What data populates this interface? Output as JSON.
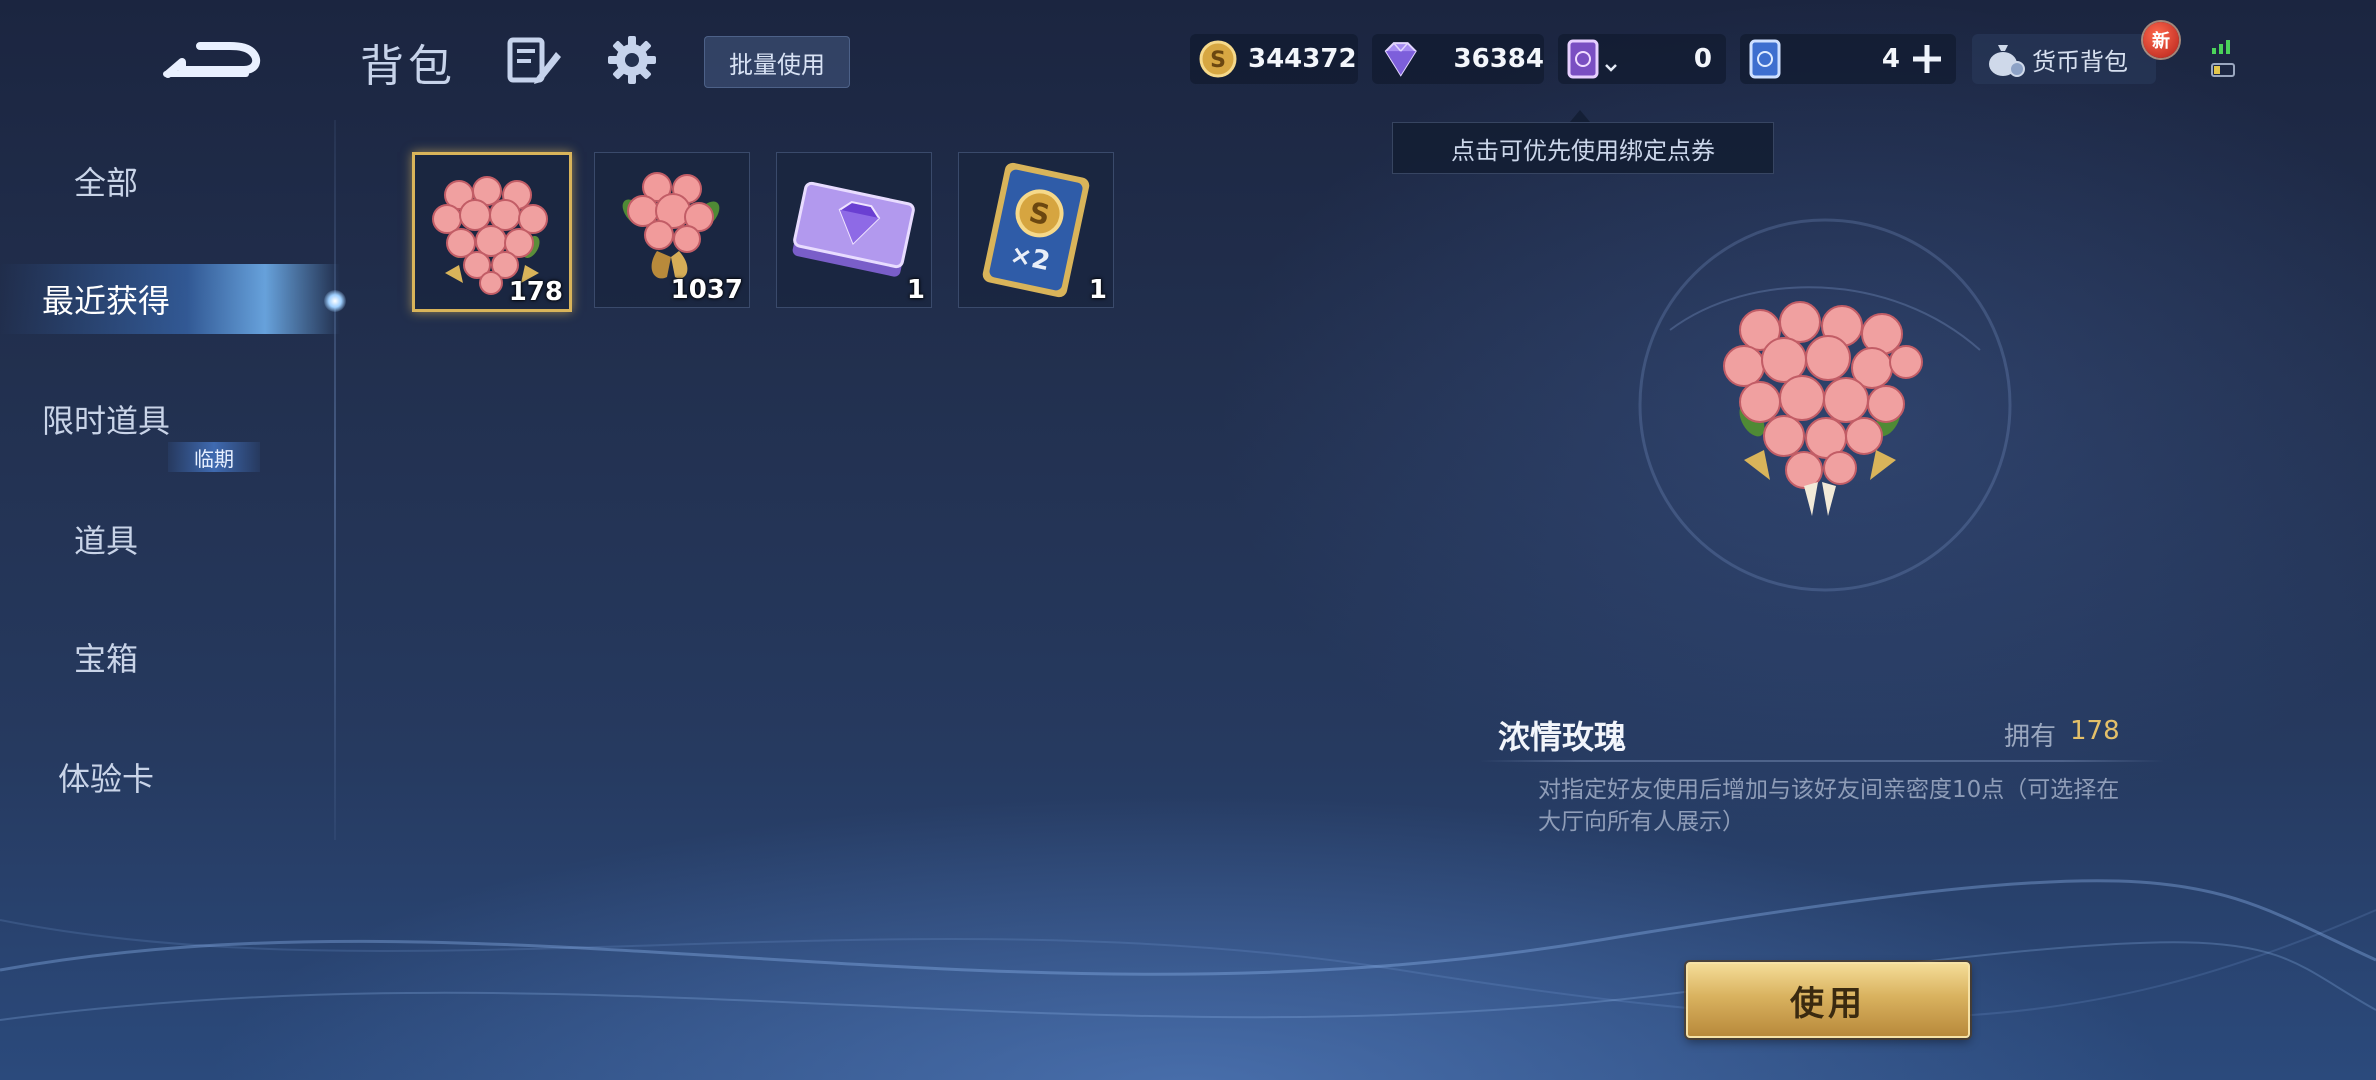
{
  "header": {
    "title": "背包",
    "batch_use": "批量使用"
  },
  "currencies": {
    "gold": "344372",
    "gems": "36384",
    "card1": "0",
    "card2": "4",
    "wallet_label": "货币背包",
    "new_badge": "新"
  },
  "tooltip": "点击可优先使用绑定点券",
  "sidebar": {
    "items": [
      {
        "label": "全部"
      },
      {
        "label": "最近获得"
      },
      {
        "label": "限时道具"
      },
      {
        "label": "道具"
      },
      {
        "label": "宝箱"
      },
      {
        "label": "体验卡"
      }
    ],
    "expiring_tag": "临期"
  },
  "items": [
    {
      "name": "rose-bouquet-heart",
      "count": "178"
    },
    {
      "name": "rose-bouquet",
      "count": "1037"
    },
    {
      "name": "diamond-ticket",
      "count": "1"
    },
    {
      "name": "gold-double-card",
      "count": "1"
    }
  ],
  "detail": {
    "name": "浓情玫瑰",
    "own_label": "拥有",
    "own_count": "178",
    "description": "对指定好友使用后增加与该好友间亲密度10点（可选择在大厅向所有人展示）"
  },
  "use_button": "使用",
  "icons": {
    "back": "back-arrow-icon",
    "edit": "edit-icon",
    "settings": "gear-icon",
    "gold": "gold-coin-icon",
    "gems": "diamond-icon",
    "card1": "purple-card-icon",
    "card2": "blue-card-icon",
    "add": "plus-icon",
    "wallet": "money-bag-icon",
    "signal": "signal-icon",
    "battery": "battery-icon"
  },
  "colors": {
    "accent_gold": "#e4c069",
    "selected_border": "#d9b45a",
    "active_tab": "#78beff"
  }
}
